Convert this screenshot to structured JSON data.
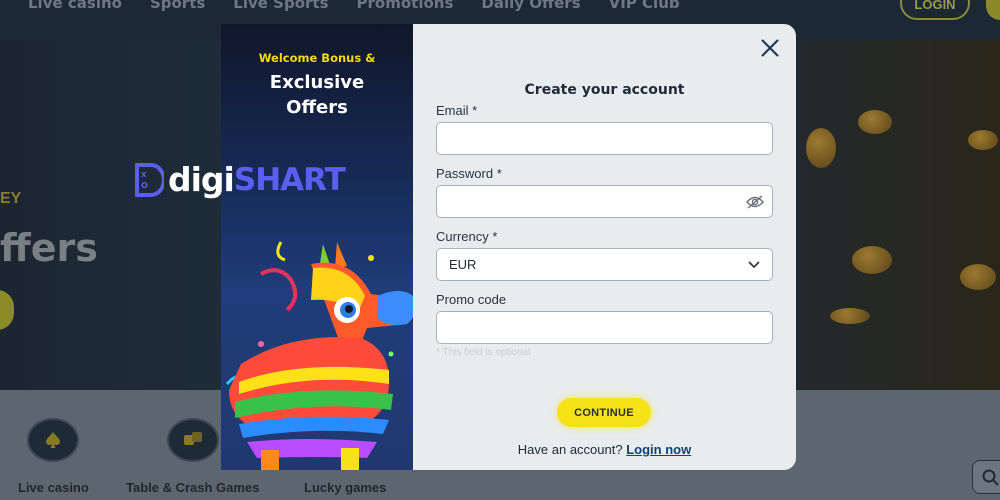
{
  "background": {
    "nav": [
      "Live casino",
      "Sports",
      "Live Sports",
      "Promotions",
      "Daily Offers",
      "VIP Club"
    ],
    "login_label": "LOGIN",
    "hero_small": "EY",
    "hero_big": "ffers",
    "categories": [
      {
        "label": "Live casino",
        "icon": "spade-icon"
      },
      {
        "label": "Table & Crash Games",
        "icon": "dice-icon"
      },
      {
        "label": "Lucky games",
        "icon": ""
      }
    ]
  },
  "promo": {
    "welcome": "Welcome Bonus &",
    "title_line1": "Exclusive",
    "title_line2": "Offers"
  },
  "logo": {
    "part1": "digi",
    "part2": "SHART"
  },
  "form": {
    "title": "Create your account",
    "email_label": "Email *",
    "email_value": "",
    "password_label": "Password *",
    "password_value": "",
    "currency_label": "Currency *",
    "currency_value": "EUR",
    "promo_label": "Promo code",
    "promo_value": "",
    "hint": "* This field is optional",
    "continue_label": "CONTINUE",
    "have_account": "Have an account?",
    "login_now": "Login now"
  },
  "colors": {
    "accent_yellow": "#f7e21a",
    "link_blue": "#13406d",
    "logo_purple": "#5b5ff0"
  }
}
